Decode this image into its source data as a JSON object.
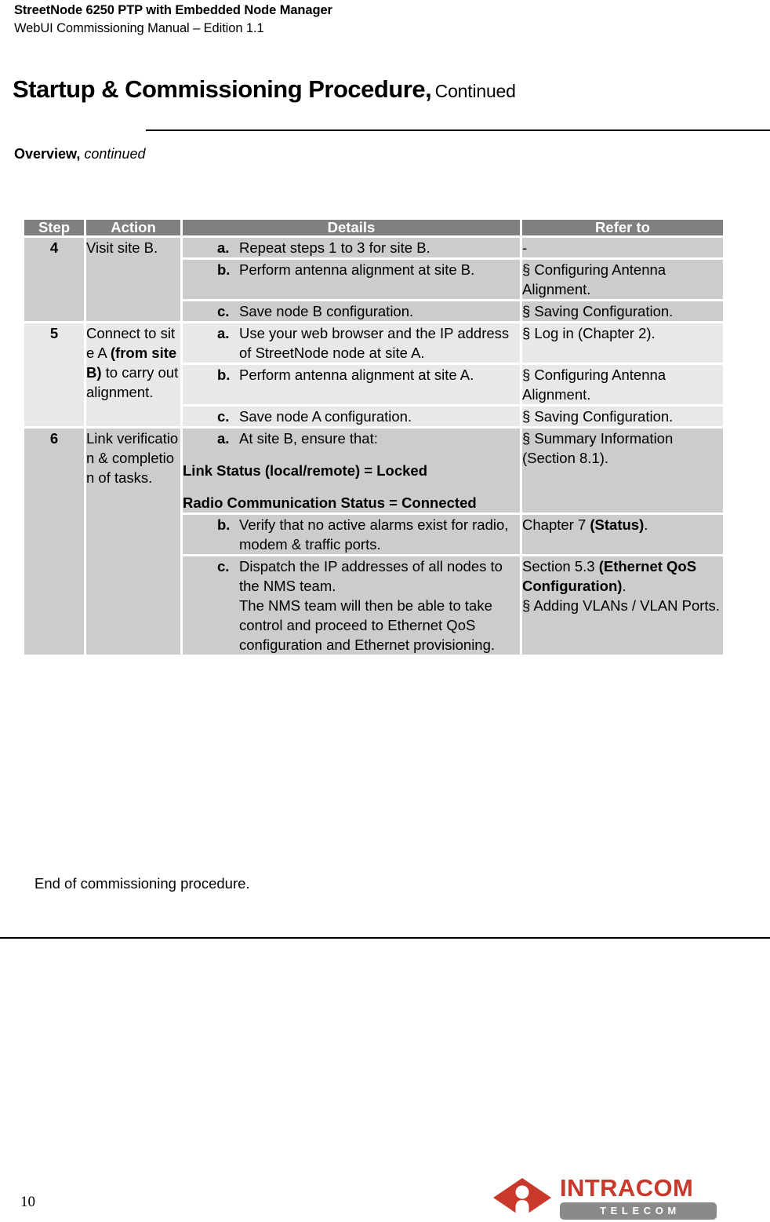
{
  "header": {
    "line1": "StreetNode 6250 PTP with Embedded Node Manager",
    "line2": "WebUI Commissioning Manual – Edition 1.1"
  },
  "title": {
    "main": "Startup & Commissioning Procedure,",
    "continued": "Continued"
  },
  "block_label": {
    "bold": "Overview,",
    "italic": "continued"
  },
  "table": {
    "columns": [
      "Step",
      "Action",
      "Details",
      "Refer to"
    ],
    "rows": [
      {
        "step": "4",
        "action": "Visit site B.",
        "shade": "dark",
        "items": [
          {
            "marker": "a.",
            "details": "Repeat steps 1 to 3 for site B.",
            "refer": "-"
          },
          {
            "marker": "b.",
            "details": "Perform antenna alignment at site B.",
            "refer": "§ Configuring Antenna Alignment."
          },
          {
            "marker": "c.",
            "details": "Save node B configuration.",
            "refer": "§ Saving Configuration."
          }
        ]
      },
      {
        "step": "5",
        "action_parts": [
          "Connect to site A ",
          "(from site B)",
          " to carry out alignment."
        ],
        "shade": "light",
        "items": [
          {
            "marker": "a.",
            "details": "Use your web browser and the IP address of StreetNode node at site A.",
            "refer": "§ Log in (Chapter 2)."
          },
          {
            "marker": "b.",
            "details": "Perform antenna alignment at site A.",
            "refer": "§ Configuring Antenna Alignment."
          },
          {
            "marker": "c.",
            "details": "Save node A configuration.",
            "refer": "§ Saving Configuration."
          }
        ]
      },
      {
        "step": "6",
        "action": "Link verification & completion of tasks.",
        "shade": "dark",
        "items": [
          {
            "marker": "a.",
            "details": "At site B, ensure that:",
            "bold_lines": [
              "Link Status (local/remote) = Locked",
              "Radio Communication Status = Connected"
            ],
            "refer": "§ Summary Information (Section 8.1)."
          },
          {
            "marker": "b.",
            "details": "Verify that no active alarms exist for radio, modem & traffic ports.",
            "refer_parts": [
              "Chapter 7 ",
              "(Status)",
              "."
            ]
          },
          {
            "marker": "c.",
            "details": "Dispatch the IP addresses of all nodes to the NMS team.",
            "details_line2": "The NMS team will then be able to take control and proceed to Ethernet QoS configuration and Ethernet provisioning.",
            "refer_parts": [
              "Section 5.3 ",
              "(Ethernet QoS Configuration)",
              "."
            ],
            "refer_line2": "§ Adding VLANs / VLAN Ports."
          }
        ]
      }
    ]
  },
  "end_note": "End of commissioning procedure.",
  "footer": {
    "page_number": "10",
    "brand_name": "INTRACOM",
    "brand_sub": "TELECOM",
    "brand_color": "#c8392b",
    "brand_sub_bg": "#8a8a8a"
  }
}
